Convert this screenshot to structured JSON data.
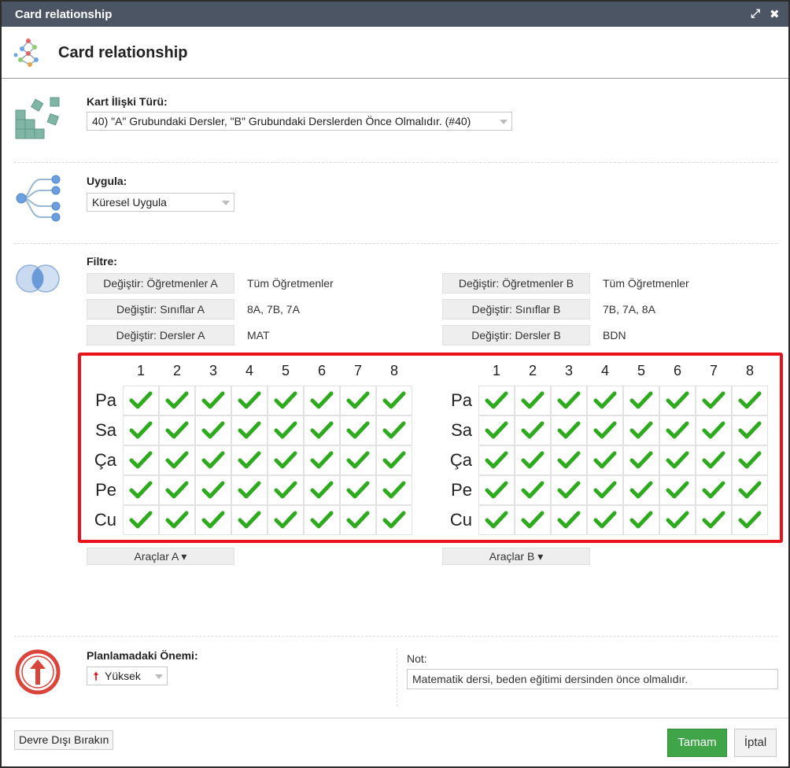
{
  "window": {
    "title": "Card relationship",
    "maximize_icon": "expand-icon",
    "close_icon": "close-icon"
  },
  "header": {
    "title": "Card relationship",
    "logo_icon": "network-graph-icon"
  },
  "relation_type": {
    "label": "Kart İlişki Türü:",
    "value": "40) \"A\" Grubundaki Dersler, \"B\" Grubundaki Derslerden Önce Olmalıdır. (#40)"
  },
  "apply": {
    "label": "Uygula:",
    "value": "Küresel Uygula"
  },
  "filter": {
    "label": "Filtre:",
    "a": {
      "teachers_button": "Değiştir: Öğretmenler A",
      "teachers_value": "Tüm Öğretmenler",
      "classes_button": "Değiştir: Sınıflar A",
      "classes_value": "8A, 7B, 7A",
      "subjects_button": "Değiştir: Dersler A",
      "subjects_value": "MAT"
    },
    "b": {
      "teachers_button": "Değiştir: Öğretmenler B",
      "teachers_value": "Tüm Öğretmenler",
      "classes_button": "Değiştir: Sınıflar B",
      "classes_value": "7B, 7A, 8A",
      "subjects_button": "Değiştir: Dersler B",
      "subjects_value": "BDN"
    }
  },
  "grid": {
    "periods": [
      "1",
      "2",
      "3",
      "4",
      "5",
      "6",
      "7",
      "8"
    ],
    "days": [
      "Pa",
      "Sa",
      "Ça",
      "Pe",
      "Cu"
    ],
    "check_color": "#2eaa1e",
    "all_checked": true
  },
  "tools": {
    "a": "Araçlar A ▾",
    "b": "Araçlar B ▾"
  },
  "priority": {
    "label": "Planlamadaki Önemi:",
    "value": "Yüksek",
    "icon": "arrow-up-icon"
  },
  "note": {
    "label": "Not:",
    "value": "Matematik dersi, beden eğitimi dersinden önce olmalıdır."
  },
  "footer": {
    "disable": "Devre Dışı Bırakın",
    "ok": "Tamam",
    "cancel": "İptal"
  },
  "colors": {
    "titlebar": "#4b5563",
    "ok_button": "#3fa548",
    "highlight": "#e8131a"
  }
}
